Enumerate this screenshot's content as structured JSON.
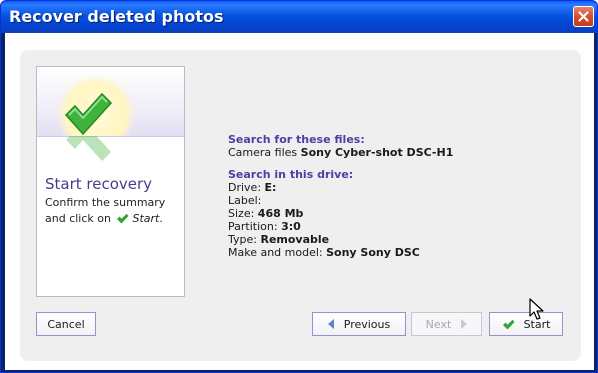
{
  "window": {
    "title": "Recover deleted photos"
  },
  "sidebar": {
    "title": "Start recovery",
    "line1": "Confirm the summary",
    "line2_prefix": "and click on",
    "line2_action": "Start",
    "line2_suffix": "."
  },
  "summary": {
    "files_heading": "Search for these files:",
    "camera_label": "Camera files",
    "camera_value": "Sony Cyber-shot DSC-H1",
    "drive_heading": "Search in this drive:",
    "drive_label": "Drive:",
    "drive_value": "E:",
    "label_label": "Label:",
    "label_value": "",
    "size_label": "Size:",
    "size_value": "468 Mb",
    "partition_label": "Partition:",
    "partition_value": "3:0",
    "type_label": "Type:",
    "type_value": "Removable",
    "make_label": "Make and model:",
    "make_value": "Sony Sony DSC"
  },
  "buttons": {
    "cancel": "Cancel",
    "previous": "Previous",
    "next": "Next",
    "start": "Start"
  },
  "colors": {
    "titlebar": "#0454e0",
    "accent": "#4b3fa5",
    "check": "#33a532"
  }
}
